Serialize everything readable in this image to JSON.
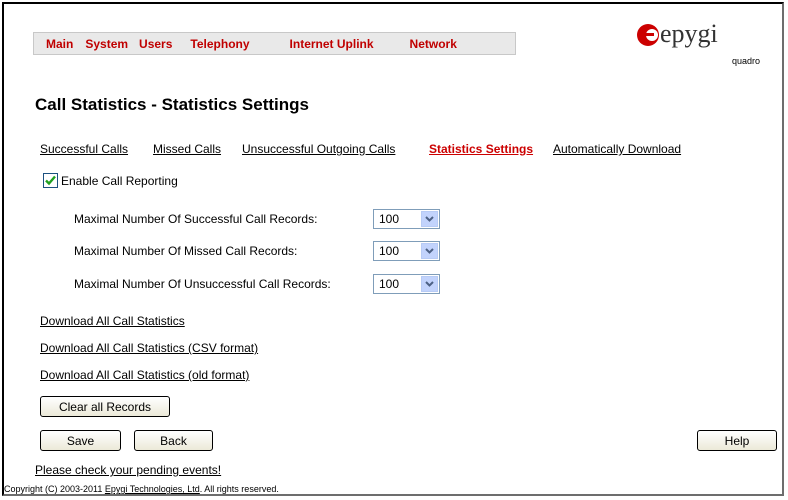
{
  "menu": {
    "items": [
      {
        "label": "Main"
      },
      {
        "label": "System"
      },
      {
        "label": "Users"
      },
      {
        "label": "Telephony"
      },
      {
        "label": "Internet Uplink"
      },
      {
        "label": "Network"
      }
    ]
  },
  "logo": {
    "brand": "epygi",
    "product": "quadro",
    "accent": "#cc0000"
  },
  "page": {
    "title": "Call Statistics - Statistics Settings"
  },
  "tabs": [
    {
      "label": "Successful Calls"
    },
    {
      "label": "Missed Calls"
    },
    {
      "label": "Unsuccessful Outgoing Calls"
    },
    {
      "label": "Statistics Settings",
      "active": true
    },
    {
      "label": "Automatically Download"
    }
  ],
  "settings": {
    "enable_label": "Enable Call Reporting",
    "enable_checked": true,
    "rows": [
      {
        "label": "Maximal Number Of Successful Call Records:",
        "value": "100"
      },
      {
        "label": "Maximal Number Of Missed Call Records:",
        "value": "100"
      },
      {
        "label": "Maximal Number Of Unsuccessful Call Records:",
        "value": "100"
      }
    ]
  },
  "downloads": [
    {
      "label": "Download All Call Statistics"
    },
    {
      "label": "Download All Call Statistics (CSV format)"
    },
    {
      "label": "Download All Call Statistics (old format)"
    }
  ],
  "buttons": {
    "clear": "Clear all Records",
    "save": "Save",
    "back": "Back",
    "help": "Help"
  },
  "footer": {
    "pending": "Please check your pending events!",
    "copyright_prefix": "Copyright (C) 2003-2011 ",
    "company": "Epygi Technologies, Ltd",
    "copyright_suffix": ". All rights reserved."
  }
}
